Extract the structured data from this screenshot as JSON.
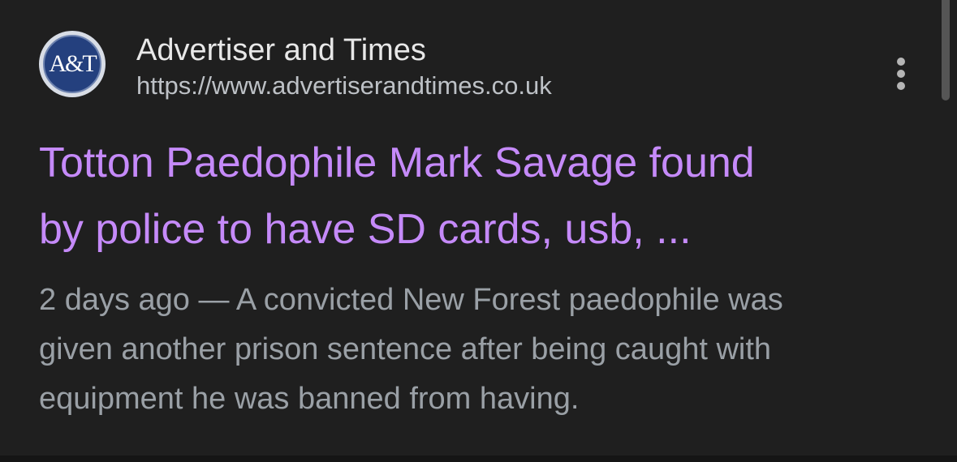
{
  "result": {
    "site_name": "Advertiser and Times",
    "site_url": "https://www.advertiserandtimes.co.uk",
    "favicon_text": "A&T",
    "more_icon": "more-vertical-icon",
    "title_lines": [
      "Totton Paedophile Mark Savage found",
      "by police to have SD cards, usb, ..."
    ],
    "snippet_lines": [
      "2 days ago — A convicted New Forest paedophile was",
      "given another prison sentence after being caught with",
      "equipment he was banned from having."
    ]
  },
  "colors": {
    "background": "#1f1f1f",
    "title_link": "#c58af9",
    "site_name": "#e8e8e8",
    "url": "#bdc1c6",
    "snippet": "#9aa0a6",
    "favicon_bg": "#24407e"
  }
}
